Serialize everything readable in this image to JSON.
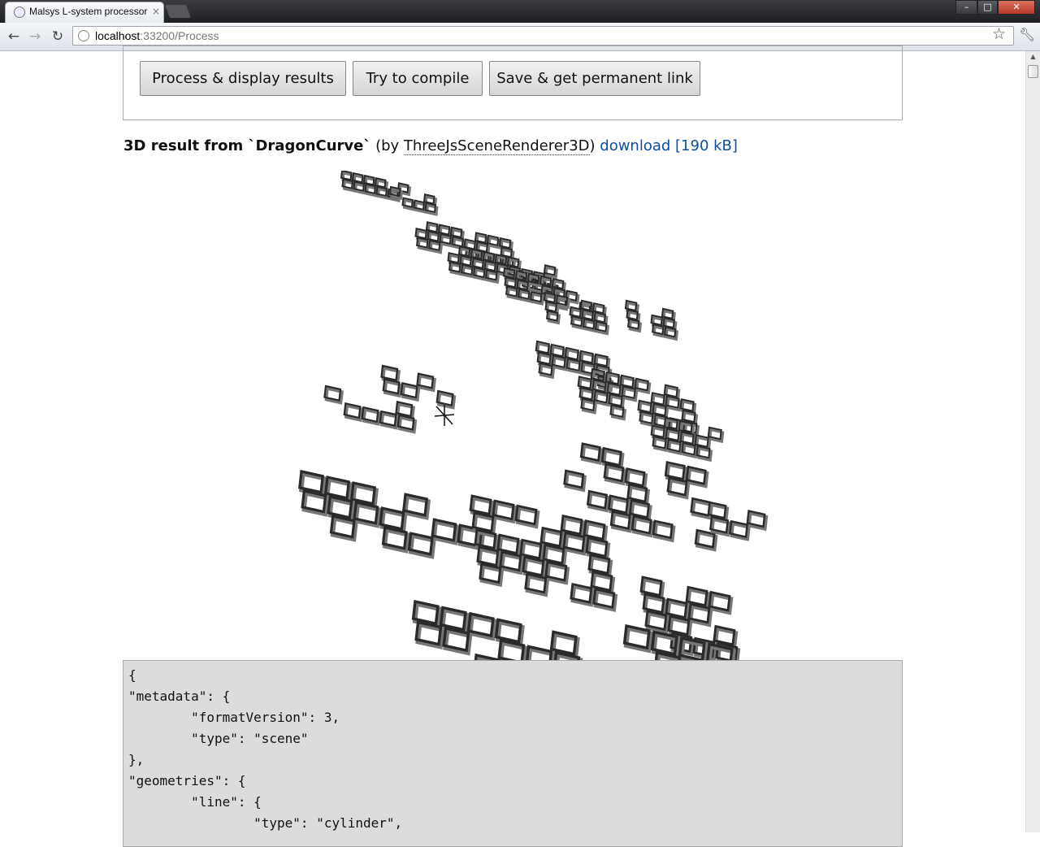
{
  "browser": {
    "tab_title": "Malsys L-system processor",
    "tab_close": "×",
    "url_host": "localhost",
    "url_path": ":33200/Process"
  },
  "buttons": {
    "process": "Process & display results",
    "compile": "Try to compile",
    "save": "Save & get permanent link"
  },
  "result": {
    "prefix": "3D result from `DragonCurve`",
    "by_open": " (by ",
    "renderer": "ThreeJsSceneRenderer3D",
    "by_close": ") ",
    "download": "download [190 kB]"
  },
  "code": {
    "lines": [
      "{",
      "\"metadata\": {",
      "        \"formatVersion\": 3,",
      "        \"type\": \"scene\"",
      "},",
      "\"geometries\": {",
      "        \"line\": {",
      "                \"type\": \"cylinder\","
    ]
  }
}
